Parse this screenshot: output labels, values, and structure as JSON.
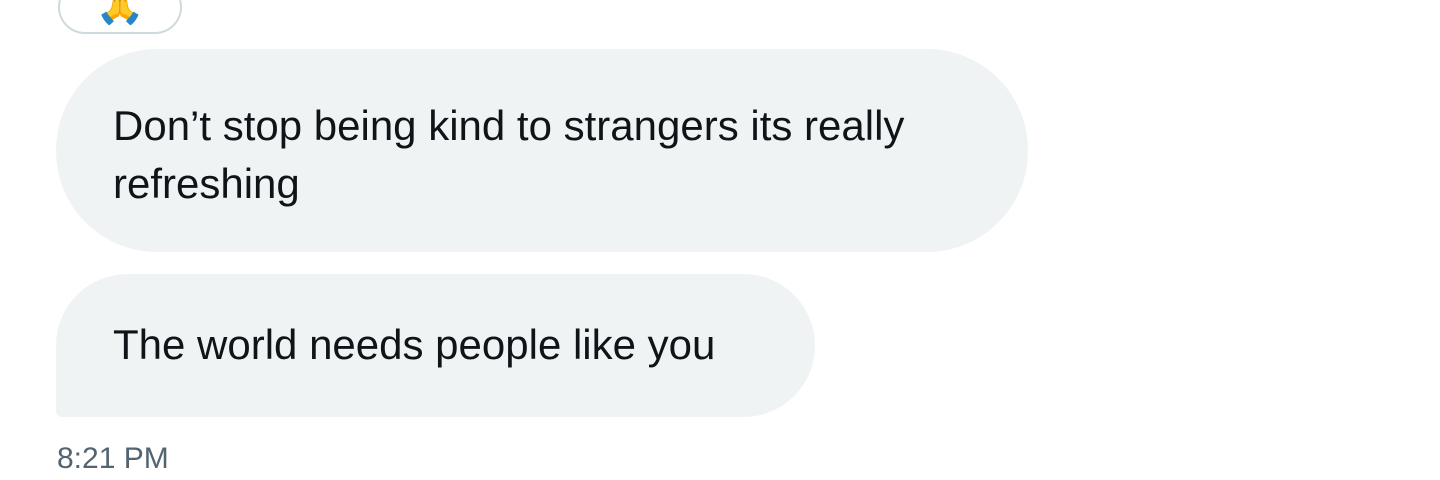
{
  "conversation": {
    "reaction": {
      "emoji": "🙏"
    },
    "messages": [
      {
        "text": "Don’t stop being kind to strangers its really refreshing"
      },
      {
        "text": "The world needs people like you"
      }
    ],
    "timestamp": "8:21 PM",
    "colors": {
      "bubble_background": "#eff3f4",
      "message_text": "#0f1419",
      "timestamp_text": "#536471",
      "reaction_border": "#cfd9de"
    }
  }
}
